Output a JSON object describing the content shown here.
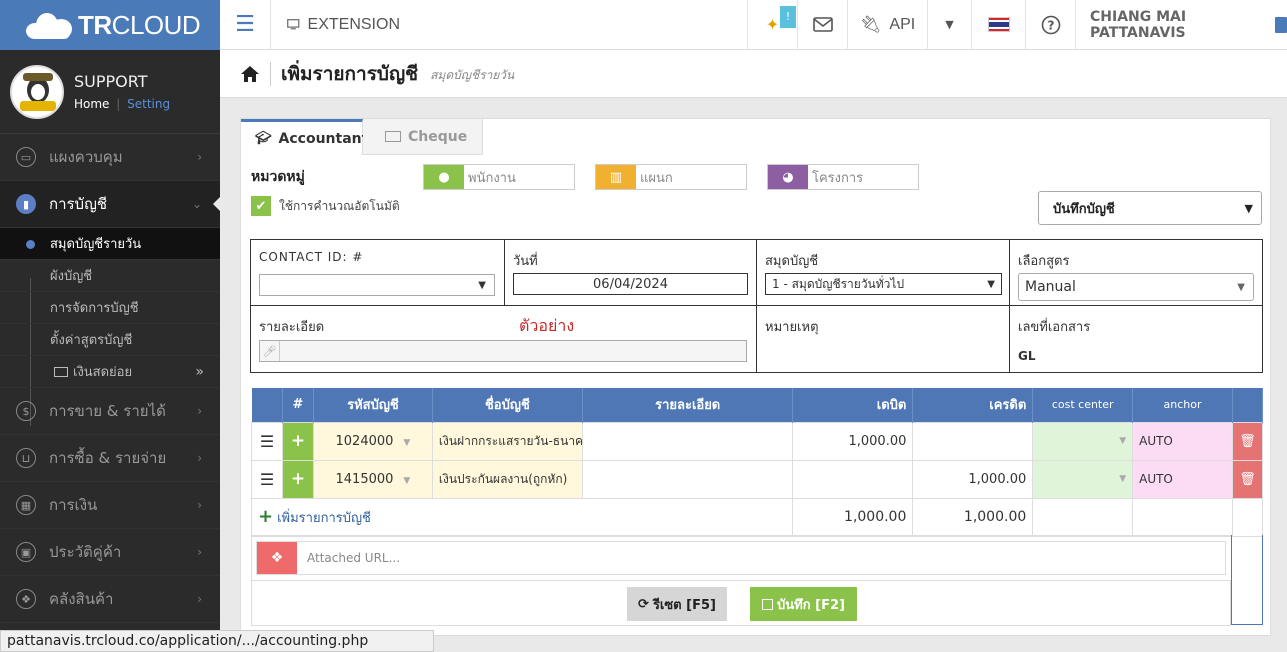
{
  "brand": {
    "tr": "TR",
    "cloud": "CLOUD"
  },
  "topbar": {
    "extension": "EXTENSION",
    "api": "API",
    "company": "CHIANG MAI PATTANAVIS",
    "notify_badge": "!"
  },
  "profile": {
    "name": "SUPPORT",
    "home": "Home",
    "sep": "|",
    "setting": "Setting"
  },
  "nav": {
    "dashboard": "แผงควบคุม",
    "accounting": "การบัญชี",
    "subs": [
      "สมุดบัญชีรายวัน",
      "ผังบัญชี",
      "การจัดการบัญชี",
      "ตั้งค่าสูตรบัญชี",
      "เงินสดย่อย"
    ],
    "sales": "การขาย & รายได้",
    "purchase": "การซื้อ & รายจ่าย",
    "finance": "การเงิน",
    "customers": "ประวัติคู่ค้า",
    "inventory": "คลังสินค้า"
  },
  "page": {
    "title": "เพิ่มรายการบัญชี",
    "subtitle": "สมุดบัญชีรายวัน"
  },
  "tabs": {
    "accountant": "Accountant",
    "cheque": "Cheque"
  },
  "form": {
    "category": "หมวดหมู่",
    "employee_ph": "พนักงาน",
    "department_ph": "แผนก",
    "project_ph": "โครงการ",
    "auto_calc": "ใช้การคำนวณอัตโนมัติ",
    "save_mode": "บันทึกบัญชี",
    "contact_label": "CONTACT ID: #",
    "date_label": "วันที่",
    "date_value": "06/04/2024",
    "journal_label": "สมุดบัญชี",
    "journal_value": "1 - สมุดบัญชีรายวันทั่วไป",
    "formula_label": "เลือกสูตร",
    "formula_value": "Manual",
    "detail_label": "รายละเอียด",
    "example": "ตัวอย่าง",
    "remark_label": "หมายเหตุ",
    "docno_label": "เลขที่เอกสาร",
    "docno_value": "GL"
  },
  "table": {
    "headers": [
      "#",
      "รหัสบัญชี",
      "ชื่อบัญชี",
      "รายละเอียด",
      "เดบิต",
      "เครดิต",
      "cost center",
      "anchor"
    ],
    "rows": [
      {
        "code": "1024000",
        "name": "เงินฝากกระแสรายวัน-ธนาค",
        "detail": "",
        "debit": "1,000.00",
        "credit": "",
        "cost": "",
        "anchor": "AUTO"
      },
      {
        "code": "1415000",
        "name": "เงินประกันผลงาน(ถูกหัก)",
        "detail": "",
        "debit": "",
        "credit": "1,000.00",
        "cost": "",
        "anchor": "AUTO"
      }
    ],
    "add_line": "เพิ่มรายการบัญชี",
    "total_debit": "1,000.00",
    "total_credit": "1,000.00"
  },
  "attach": {
    "placeholder": "Attached URL..."
  },
  "buttons": {
    "reset": "รีเซต [F5]",
    "save": "บันทึก [F2]"
  },
  "status_url": "pattanavis.trcloud.co/application/.../accounting.php"
}
